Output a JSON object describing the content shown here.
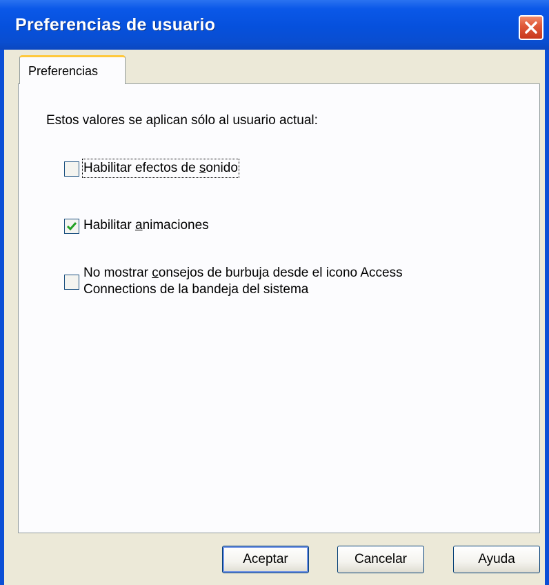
{
  "window": {
    "title": "Preferencias de usuario"
  },
  "tabs": [
    {
      "label": "Preferencias",
      "selected": true
    }
  ],
  "panel": {
    "intro": "Estos valores se aplican sólo al usuario actual:",
    "options": [
      {
        "label_pre": "Habilitar efectos de ",
        "label_mnemonic": "s",
        "label_post": "onido",
        "checked": false
      },
      {
        "label_pre": "Habilitar ",
        "label_mnemonic": "a",
        "label_post": "nimaciones",
        "checked": true
      },
      {
        "label_line1_pre": "No mostrar ",
        "label_line1_mnemonic": "c",
        "label_line1_post": "onsejos de burbuja desde el icono Access",
        "label_line2": "Connections de la bandeja del sistema",
        "checked": false
      }
    ]
  },
  "buttons": {
    "ok": "Aceptar",
    "cancel": "Cancelar",
    "help": "Ayuda"
  },
  "colors": {
    "titlebar": "#0650dc",
    "close": "#e05a3a",
    "dialog_bg": "#ece9d8",
    "tab_accent": "#ffc83c",
    "check": "#21a121"
  },
  "icons": {
    "close": "close-x-icon",
    "check": "checkmark-icon"
  }
}
